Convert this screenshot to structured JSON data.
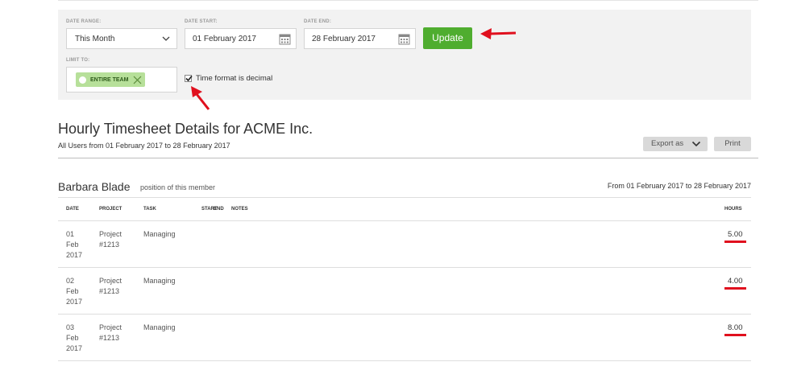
{
  "filters": {
    "date_range_label": "DATE RANGE:",
    "date_range_value": "This Month",
    "date_start_label": "DATE START:",
    "date_start_value": "01 February 2017",
    "date_end_label": "DATE END:",
    "date_end_value": "28 February 2017",
    "update_label": "Update",
    "limit_to_label": "LIMIT TO:",
    "limit_tag": "ENTIRE TEAM",
    "decimal_checkbox_label": "Time format is decimal",
    "decimal_checked": true
  },
  "report": {
    "title": "Hourly Timesheet Details for ACME Inc.",
    "subtitle": "All Users from 01 February 2017 to 28 February 2017",
    "export_label": "Export as",
    "print_label": "Print"
  },
  "member": {
    "name": "Barbara Blade",
    "position": "position of this member",
    "range": "From 01 February 2017 to 28 February 2017"
  },
  "table": {
    "headers": {
      "date": "DATE",
      "project": "PROJECT",
      "task": "TASK",
      "start": "START",
      "end": "END",
      "notes": "NOTES",
      "hours": "HOURS"
    },
    "rows": [
      {
        "day": "01",
        "month": "Feb",
        "year": "2017",
        "project_1": "Project",
        "project_2": "#1213",
        "task": "Managing",
        "hours": "5.00"
      },
      {
        "day": "02",
        "month": "Feb",
        "year": "2017",
        "project_1": "Project",
        "project_2": "#1213",
        "task": "Managing",
        "hours": "4.00"
      },
      {
        "day": "03",
        "month": "Feb",
        "year": "2017",
        "project_1": "Project",
        "project_2": "#1213",
        "task": "Managing",
        "hours": "8.00"
      }
    ]
  },
  "colors": {
    "update_button": "#4fad2f",
    "tag_background": "#b7e09a",
    "annotation_red": "#e0101e"
  },
  "icons": [
    "chevron-down-icon",
    "calendar-icon",
    "close-icon",
    "checkmark-icon",
    "annotation-arrow-icon"
  ]
}
